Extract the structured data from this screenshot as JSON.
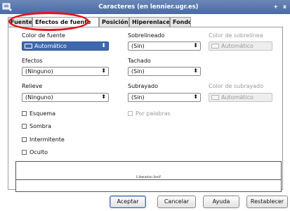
{
  "window": {
    "title": "Caracteres (en lennier.ugr.es)",
    "controls": "+ x"
  },
  "tabs": [
    {
      "label": "Fuente"
    },
    {
      "label": "Efectos de fuente"
    },
    {
      "label": "Posición"
    },
    {
      "label": "Hiperenlace"
    },
    {
      "label": "Fondo"
    }
  ],
  "left": {
    "font_color_label": "Color de fuente",
    "font_color_value": "Automático",
    "effects_label": "Efectos",
    "effects_value": "(Ninguno)",
    "relief_label": "Relieve",
    "relief_value": "(Ninguno)",
    "checkboxes": [
      {
        "label": "Esquema"
      },
      {
        "label": "Sombra"
      },
      {
        "label": "Intermitente"
      },
      {
        "label": "Oculto"
      }
    ]
  },
  "right": {
    "overline_label": "Sobrelineado",
    "overline_value": "(Sin)",
    "overline_color_label": "Color de sobrelínea",
    "overline_color_value": "Automático",
    "strikethrough_label": "Tachado",
    "strikethrough_value": "(Sin)",
    "underline_label": "Subrayado",
    "underline_value": "(Sin)",
    "underline_color_label": "Color de subrayado",
    "underline_color_value": "Automático",
    "by_words_label": "Por palabras"
  },
  "preview": {
    "text": "Liberation Serif"
  },
  "buttons": {
    "ok": "Aceptar",
    "cancel": "Cancelar",
    "help": "Ayuda",
    "reset": "Restablecer"
  },
  "colors": {
    "title_bar": "#4a6aa3",
    "selection": "#3e68b1",
    "highlight": "#e0141c"
  }
}
